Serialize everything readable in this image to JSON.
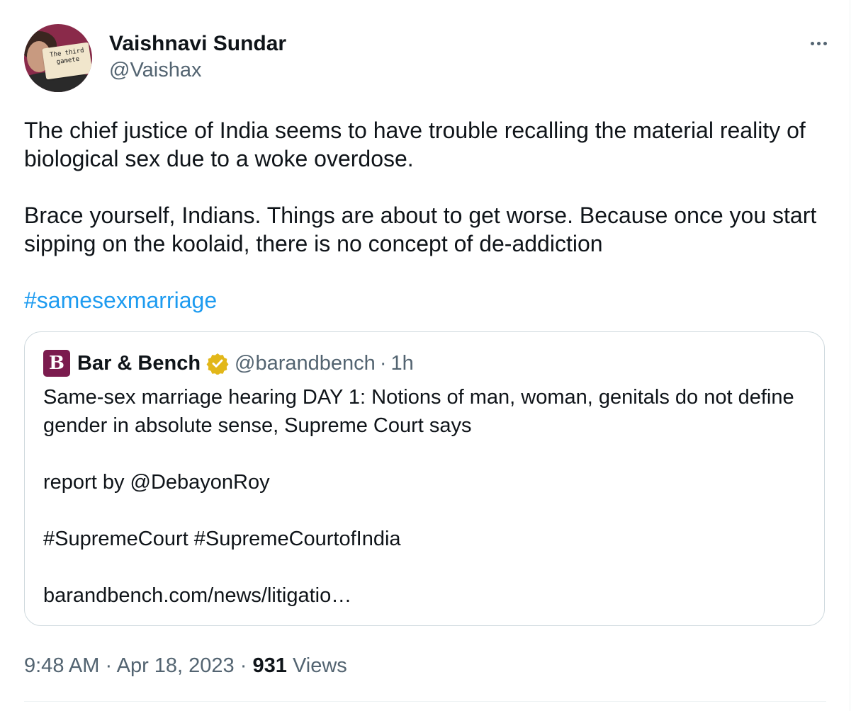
{
  "tweet": {
    "display_name": "Vaishnavi Sundar",
    "handle": "@Vaishax",
    "avatar_card_text": "The third gamete",
    "more_icon": "more-horizontal-icon",
    "text_paragraph_1": "The chief justice of India seems to have trouble recalling the material reality of biological sex due to a woke overdose.",
    "text_paragraph_2": "Brace yourself, Indians. Things are about to get worse. Because once you start sipping on the koolaid, there is no concept of de-addiction",
    "hashtag": "#samesexmarriage",
    "hashtag_color": "#1d9bf0"
  },
  "quote": {
    "avatar_letter": "B",
    "avatar_color": "#7b1b4e",
    "name": "Bar & Bench",
    "verified_icon": "verified-gold-badge-icon",
    "verified_color": "#e2b719",
    "handle": "@barandbench",
    "separator": "·",
    "time": "1h",
    "text_line_1": "Same-sex marriage hearing DAY 1: Notions of man, woman, genitals do not define gender in absolute sense, Supreme Court says",
    "text_line_2": "report by @DebayonRoy",
    "text_line_3": "#SupremeCourt #SupremeCourtofIndia",
    "text_line_4": "barandbench.com/news/litigatio…"
  },
  "meta": {
    "time": "9:48 AM",
    "separator_1": "·",
    "date": "Apr 18, 2023",
    "separator_2": "·",
    "views_count": "931",
    "views_label": "Views"
  }
}
